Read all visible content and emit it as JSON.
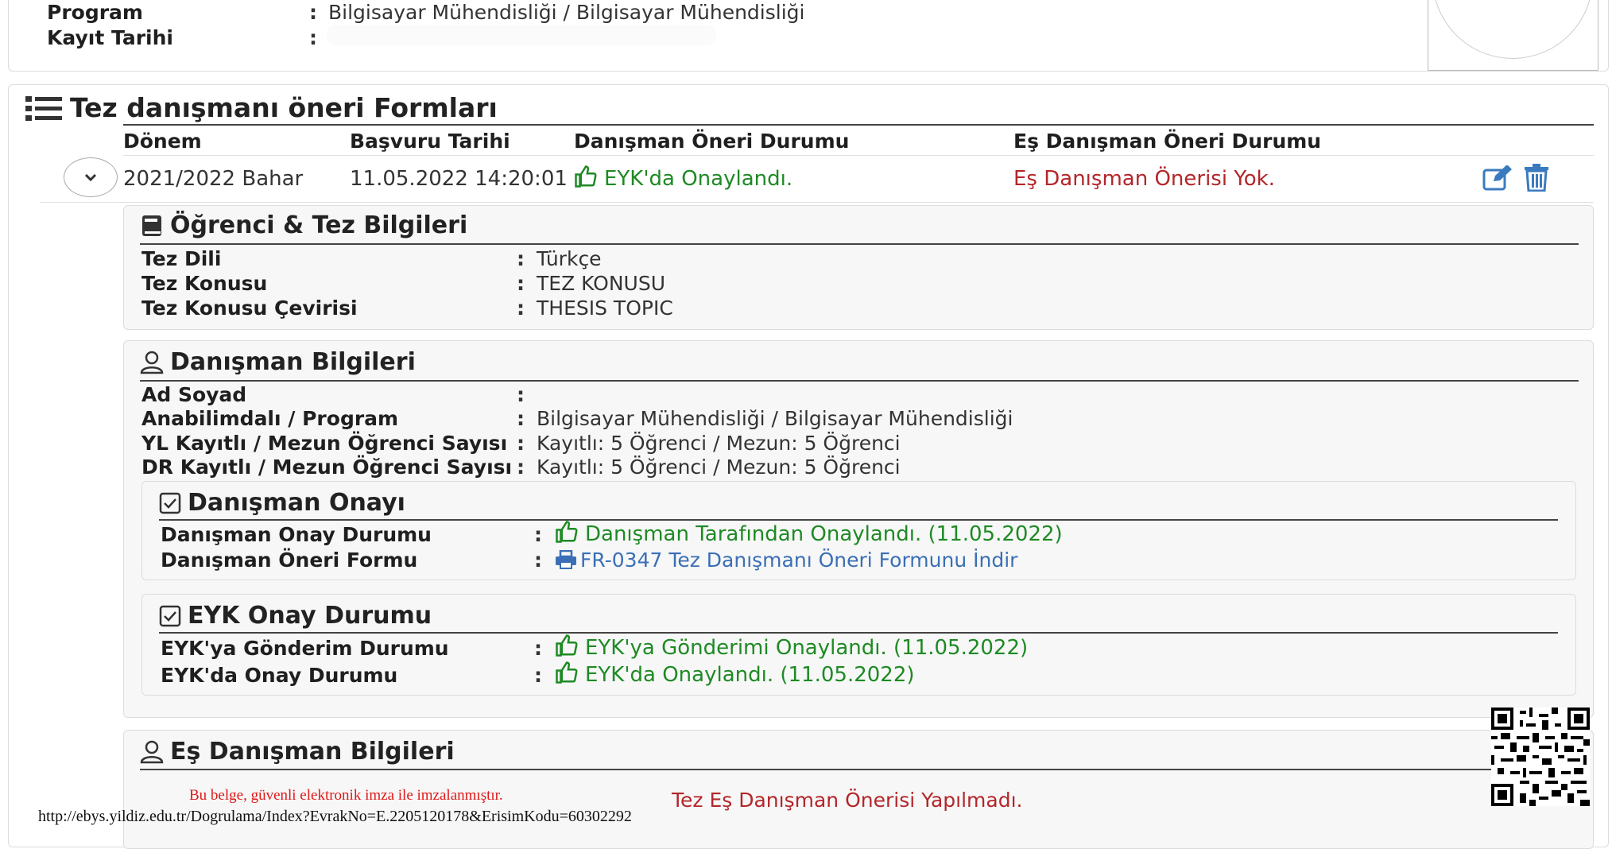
{
  "student_info": {
    "program_label": "Program",
    "program_value": "Bilgisayar Mühendisliği / Bilgisayar Mühendisliği",
    "kayit_label": "Kayıt Tarihi"
  },
  "forms_section": {
    "title": "Tez danışmanı öneri Formları",
    "columns": [
      "Dönem",
      "Başvuru Tarihi",
      "Danışman Öneri Durumu",
      "Eş Danışman Öneri Durumu"
    ],
    "row": {
      "donem": "2021/2022 Bahar",
      "basvuru": "11.05.2022 14:20:01",
      "danisman_durum": "EYK'da Onaylandı.",
      "es_danisman_durum": "Eş Danışman Önerisi Yok."
    }
  },
  "ogrenci_tez": {
    "title": "Öğrenci & Tez Bilgileri",
    "fields": [
      {
        "label": "Tez Dili",
        "value": "Türkçe"
      },
      {
        "label": "Tez Konusu",
        "value": "TEZ KONUSU"
      },
      {
        "label": "Tez Konusu Çevirisi",
        "value": "THESIS TOPIC"
      }
    ]
  },
  "danisman": {
    "title": "Danışman Bilgileri",
    "fields": [
      {
        "label": "Ad Soyad",
        "value": ""
      },
      {
        "label": "Anabilimdalı / Program",
        "value": "Bilgisayar Mühendisliği / Bilgisayar Mühendisliği"
      },
      {
        "label": "YL Kayıtlı / Mezun Öğrenci Sayısı",
        "value": "Kayıtlı: 5 Öğrenci / Mezun: 5 Öğrenci"
      },
      {
        "label": "DR Kayıtlı / Mezun Öğrenci Sayısı",
        "value": "Kayıtlı: 5 Öğrenci / Mezun: 5 Öğrenci"
      }
    ]
  },
  "danisman_onayi": {
    "title": "Danışman Onayı",
    "onay_label": "Danışman Onay Durumu",
    "onay_value": "Danışman Tarafından Onaylandı. (11.05.2022)",
    "form_label": "Danışman Öneri Formu",
    "form_link": "FR-0347 Tez Danışmanı Öneri Formunu İndir"
  },
  "eyk_onay": {
    "title": "EYK Onay Durumu",
    "gonderim_label": "EYK'ya Gönderim Durumu",
    "gonderim_value": "EYK'ya Gönderimi Onaylandı. (11.05.2022)",
    "onay_label": "EYK'da Onay Durumu",
    "onay_value": "EYK'da Onaylandı. (11.05.2022)"
  },
  "es_danisman": {
    "title": "Eş Danışman Bilgileri",
    "empty_text": "Tez Eş Danışman Önerisi Yapılmadı."
  },
  "footer": {
    "signature_note": "Bu belge, güvenli elektronik imza ile imzalanmıştır.",
    "verify_url": "http://ebys.yildiz.edu.tr/Dogrulama/Index?EvrakNo=E.2205120178&ErisimKodu=60302292"
  },
  "colors": {
    "approved": "#1e8a24",
    "negative": "#b3262a",
    "link": "#3a6fb5",
    "signature": "#e01818"
  }
}
